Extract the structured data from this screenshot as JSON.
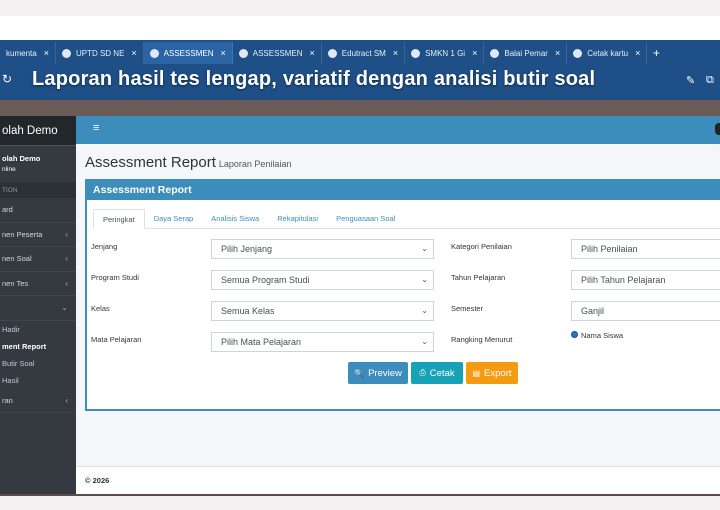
{
  "caption": "Laporan hasil tes lengap, variatif dengan analisi butir soal",
  "browser": {
    "tabs": [
      {
        "title": "kumenta",
        "active": false
      },
      {
        "title": "UPTD SD NE",
        "active": false
      },
      {
        "title": "ASSESSMEN",
        "active": true
      },
      {
        "title": "ASSESSMEN",
        "active": false
      },
      {
        "title": "Edutract SM",
        "active": false
      },
      {
        "title": "SMKN 1 Gi",
        "active": false
      },
      {
        "title": "Balai Pemar",
        "active": false
      },
      {
        "title": "Cetak kartu",
        "active": false
      }
    ],
    "close_glyph": "×",
    "new_tab_glyph": "+"
  },
  "sidebar": {
    "brand": "olah Demo",
    "user_name": "olah Demo",
    "user_status": "nline",
    "section_header": "TION",
    "items": [
      {
        "label": "ard",
        "caret": ""
      },
      {
        "label": "nen Peserta",
        "caret": "‹"
      },
      {
        "label": "nen Soal",
        "caret": "‹"
      },
      {
        "label": "nen Tes",
        "caret": "‹"
      },
      {
        "label": "",
        "caret": "⌄"
      }
    ],
    "subitems": [
      {
        "label": "Hadir",
        "active": false
      },
      {
        "label": "ment Report",
        "active": true
      },
      {
        "label": "Butir Soal",
        "active": false
      },
      {
        "label": "Hasil",
        "active": false
      }
    ],
    "last_item": {
      "label": "ran",
      "caret": "‹"
    }
  },
  "topnav": {
    "menu_icon": "≡"
  },
  "page": {
    "title": "Assessment Report",
    "subtitle": "Laporan Penilaian"
  },
  "card": {
    "title": "Assessment Report",
    "tabs": [
      "Peringkat",
      "Daya Serap",
      "Analisis Siswa",
      "Rekapitulasi",
      "Penguasaan Soal"
    ],
    "active_tab": "Peringkat"
  },
  "form": {
    "left": [
      {
        "label": "Jenjang",
        "value": "Pilih Jenjang"
      },
      {
        "label": "Program Studi",
        "value": "Semua Program Studi"
      },
      {
        "label": "Kelas",
        "value": "Semua Kelas"
      },
      {
        "label": "Mata Pelajaran",
        "value": "Pilih Mata Pelajaran"
      }
    ],
    "right": [
      {
        "label": "Kategori Penilaian",
        "value": "Pilih Penilaian"
      },
      {
        "label": "Tahun Pelajaran",
        "value": "Pilih Tahun Pelajaran"
      },
      {
        "label": "Semester",
        "value": "Ganjil"
      }
    ],
    "rank_label": "Rangking Menurut",
    "rank_option": "Nama Siswa"
  },
  "buttons": {
    "preview": "Preview",
    "cetak": "Cetak",
    "export": "Export"
  },
  "footer": {
    "text": "© 2026"
  }
}
